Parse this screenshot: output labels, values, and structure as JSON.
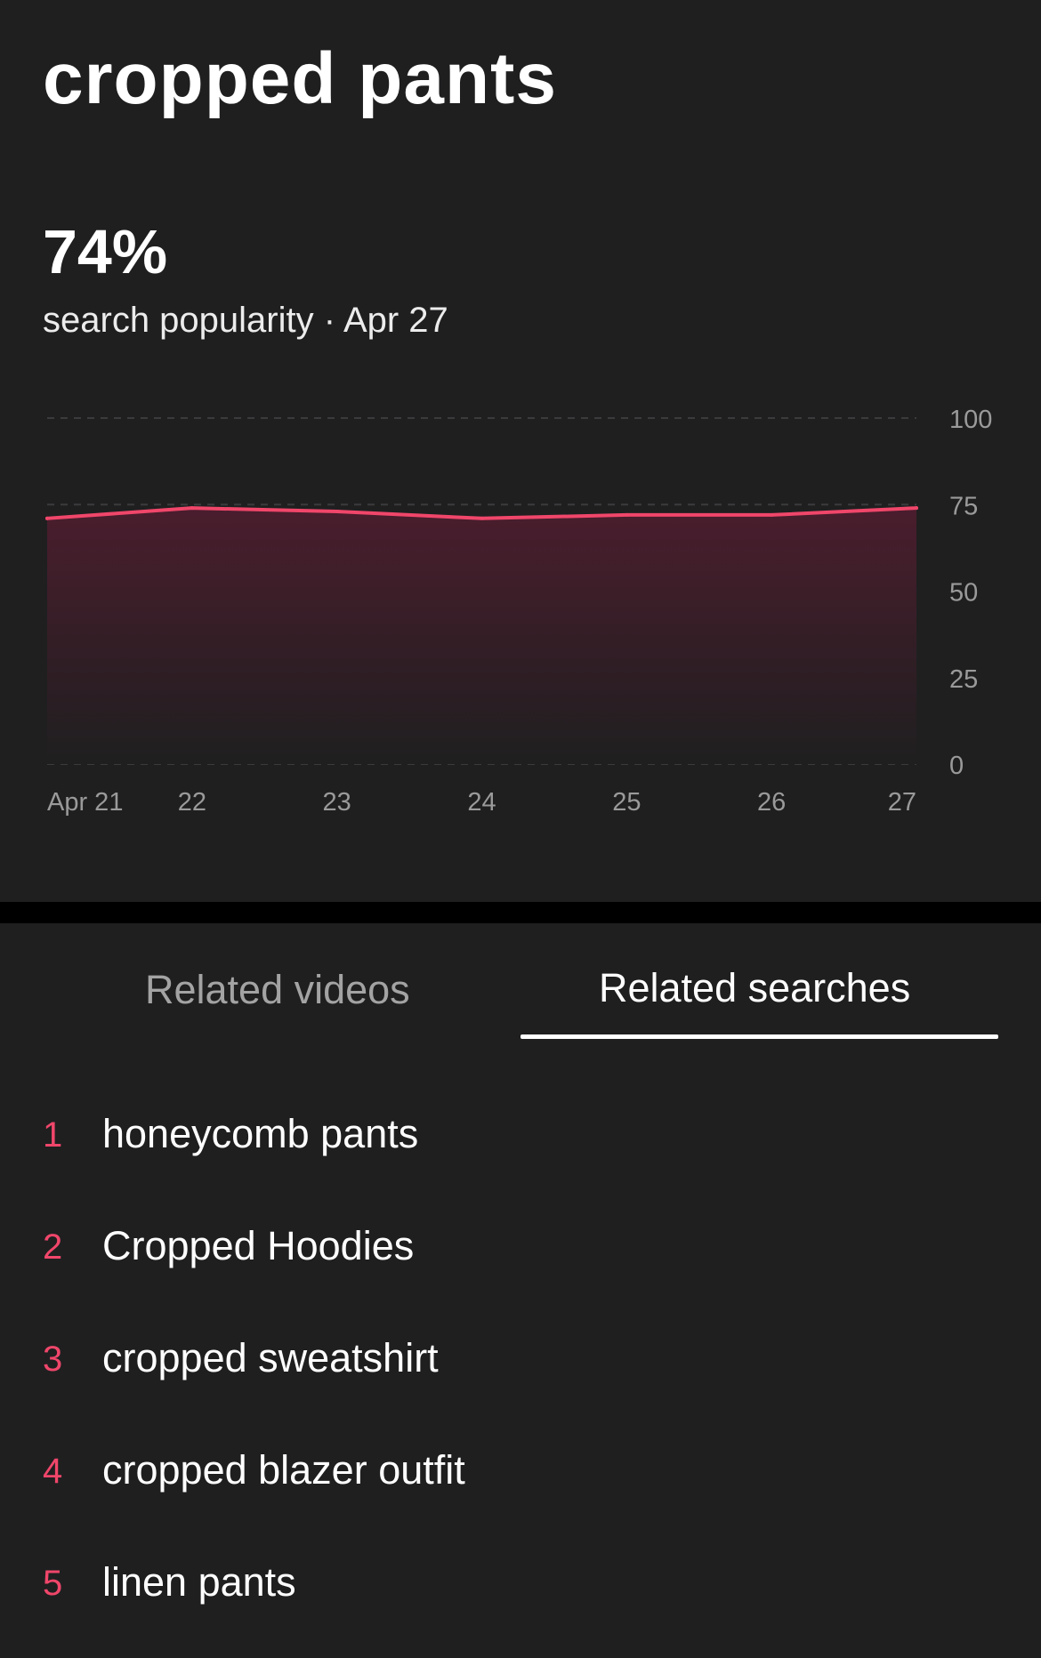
{
  "page": {
    "title": "cropped pants",
    "metric_value": "74%",
    "metric_label": "search popularity · Apr 27"
  },
  "colors": {
    "accent": "#f0466a",
    "background": "#1f1f20",
    "divider": "#000000"
  },
  "chart_data": {
    "type": "area",
    "x": [
      "Apr 21",
      "22",
      "23",
      "24",
      "25",
      "26",
      "27"
    ],
    "series": [
      {
        "values": [
          71,
          74,
          73,
          71,
          72,
          72,
          74
        ]
      }
    ],
    "ylim": [
      0,
      100
    ],
    "y_ticks": [
      "100",
      "75",
      "50",
      "25",
      "0"
    ],
    "y_tick_values": [
      100,
      75,
      50,
      25,
      0
    ],
    "y_axis_side": "right",
    "grid": "dashed horizontal",
    "line_color": "#f0466a"
  },
  "tabs": [
    {
      "label": "Related videos",
      "selected": false
    },
    {
      "label": "Related searches",
      "selected": true
    }
  ],
  "related_searches": [
    {
      "rank": "1",
      "term": "honeycomb pants"
    },
    {
      "rank": "2",
      "term": "Cropped Hoodies"
    },
    {
      "rank": "3",
      "term": "cropped sweatshirt"
    },
    {
      "rank": "4",
      "term": "cropped blazer outfit"
    },
    {
      "rank": "5",
      "term": "linen pants"
    }
  ]
}
